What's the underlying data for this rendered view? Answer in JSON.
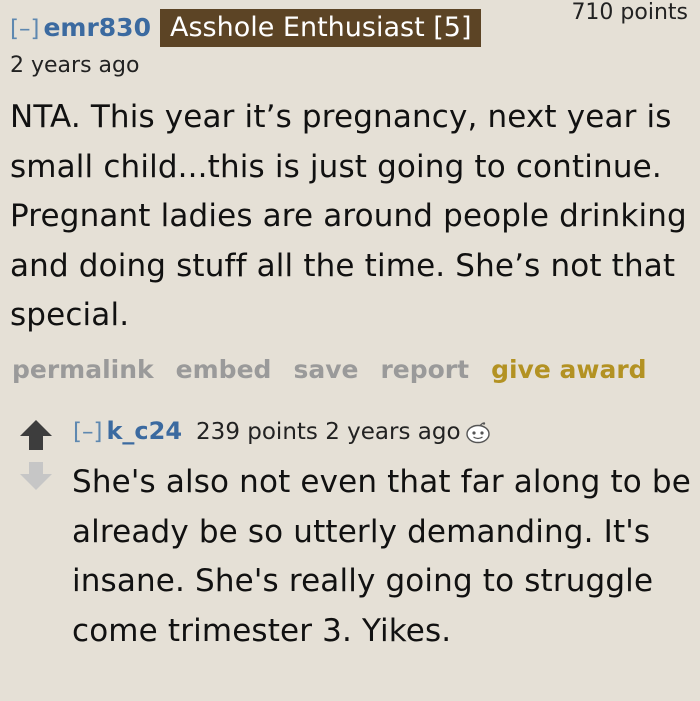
{
  "parent": {
    "collapse_label": "[–]",
    "author": "emr830",
    "flair": "Asshole Enthusiast [5]",
    "score": "710 points",
    "age": "2 years ago",
    "body": "NTA. This year it’s pregnancy, next year is small child...this is just going to continue. Pregnant ladies are around people drinking and doing stuff all the time. She’s not that special.",
    "buttons": {
      "permalink": "permalink",
      "embed": "embed",
      "save": "save",
      "report": "report",
      "give_award": "give award"
    }
  },
  "reply": {
    "collapse_label": "[–]",
    "author": "k_c24",
    "meta": "239 points 2 years ago",
    "body": "She's also not even that far along to be already be so utterly demanding. It's insane. She's really going to struggle come trimester 3. Yikes.",
    "icons": {
      "upvote": "upvote-arrow-icon",
      "downvote": "downvote-arrow-icon",
      "award": "snoo-face-icon"
    }
  },
  "colors": {
    "background": "#e5e0d6",
    "author_link": "#3b6aa0",
    "flair_background": "#5c4425",
    "award_link": "#b39223",
    "button_link": "#9a9a9a",
    "upvote_arrow": "#3d3d3d",
    "downvote_arrow": "#c6c6c6"
  }
}
